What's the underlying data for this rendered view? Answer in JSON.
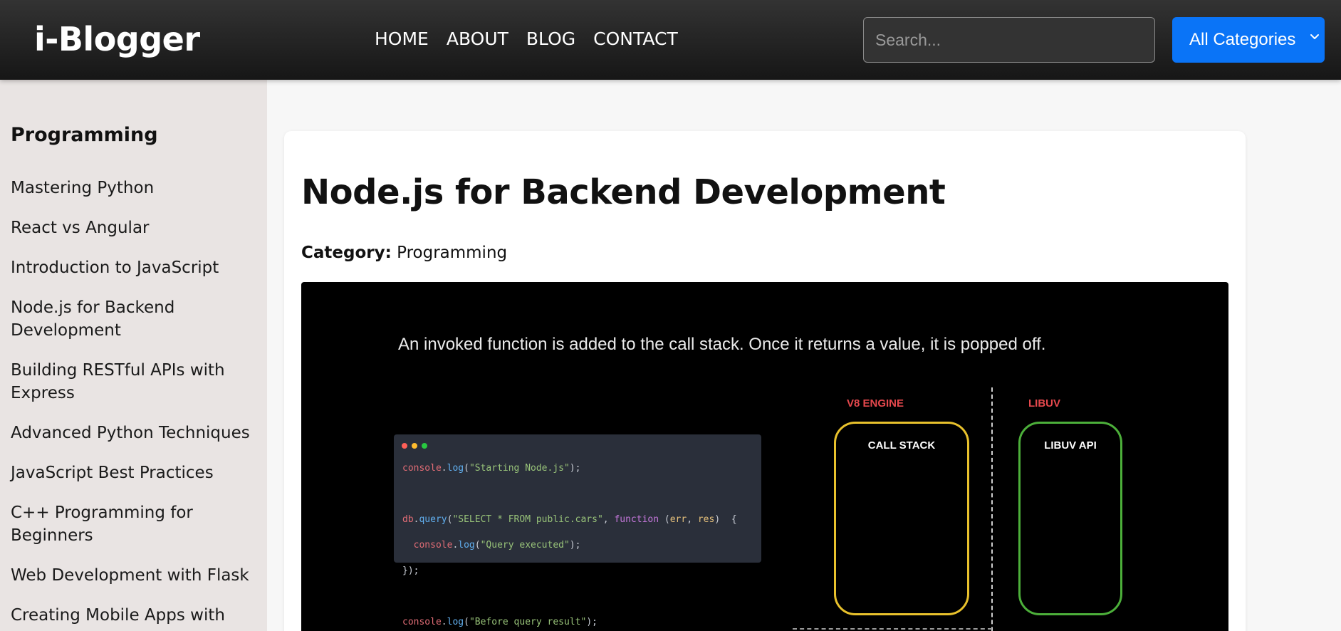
{
  "header": {
    "logo": "i-Blogger",
    "nav": [
      "HOME",
      "ABOUT",
      "BLOG",
      "CONTACT"
    ],
    "search_placeholder": "Search...",
    "category_select": "All Categories",
    "accent_color": "#0a74f7"
  },
  "sidebar": {
    "title": "Programming",
    "items": [
      "Mastering Python",
      "React vs Angular",
      "Introduction to JavaScript",
      "Node.js for Backend Development",
      "Building RESTful APIs with Express",
      "Advanced Python Techniques",
      "JavaScript Best Practices",
      "C++ Programming for Beginners",
      "Web Development with Flask",
      "Creating Mobile Apps with"
    ]
  },
  "post": {
    "title": "Node.js for Backend Development",
    "category_label": "Category:",
    "category_value": "Programming",
    "figure": {
      "caption": "An invoked function is added to the call stack. Once it returns a value, it is popped off.",
      "code_lines": [
        "console.log(\"Starting Node.js\");",
        "db.query(\"SELECT * FROM public.cars\", function (err, res)  {",
        "  console.log(\"Query executed\");",
        "});",
        "console.log(\"Before query result\");"
      ],
      "v8_label": "V8 ENGINE",
      "call_stack_label": "CALL STACK",
      "libuv_label": "LIBUV",
      "libuv_api_label": "LIBUV API",
      "v8_box_color": "#e8c12c",
      "libuv_box_color": "#4caf3a"
    }
  }
}
